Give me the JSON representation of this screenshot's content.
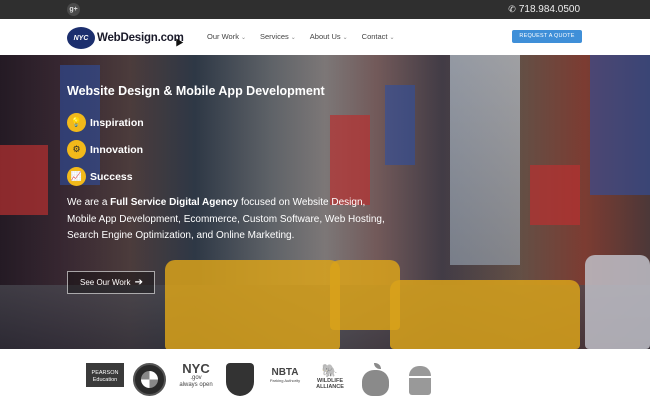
{
  "topbar": {
    "social_icon": "google-plus-icon",
    "social_glyph": "g+",
    "phone": "718.984.0500",
    "phone_icon": "phone-icon"
  },
  "header": {
    "logo_badge": "NYC",
    "logo_text": "WebDesign.com",
    "nav": [
      {
        "label": "Our Work"
      },
      {
        "label": "Services"
      },
      {
        "label": "About Us"
      },
      {
        "label": "Contact"
      }
    ],
    "quote_button": "REQUEST A QUOTE"
  },
  "hero": {
    "title": "Website Design & Mobile App Development",
    "features": [
      {
        "label": "Inspiration",
        "icon": "lightbulb-icon",
        "glyph": "💡"
      },
      {
        "label": "Innovation",
        "icon": "gear-icon",
        "glyph": "⚙"
      },
      {
        "label": "Success",
        "icon": "chart-up-icon",
        "glyph": "📈"
      }
    ],
    "desc_pre": "We are a ",
    "desc_bold": "Full Service Digital Agency",
    "desc_post": " focused on Website Design, Mobile App Development, Ecommerce, Custom Software, Web Hosting, Search Engine Optimization, and Online Marketing.",
    "cta": "See Our Work"
  },
  "clients": {
    "pearson_1": "PEARSON",
    "pearson_2": "Education",
    "nyc_1": "NYC",
    "nyc_2": ".gov",
    "nyc_3": "always open",
    "nbta": "NBTA",
    "nbta_sub": "Parking Authority",
    "wildlife_1": "WILDLIFE",
    "wildlife_2": "ALLIANCE"
  },
  "colors": {
    "accent": "#3f8fd8",
    "feature_icon": "#f2b91a",
    "topbar": "#2f2f2f"
  }
}
